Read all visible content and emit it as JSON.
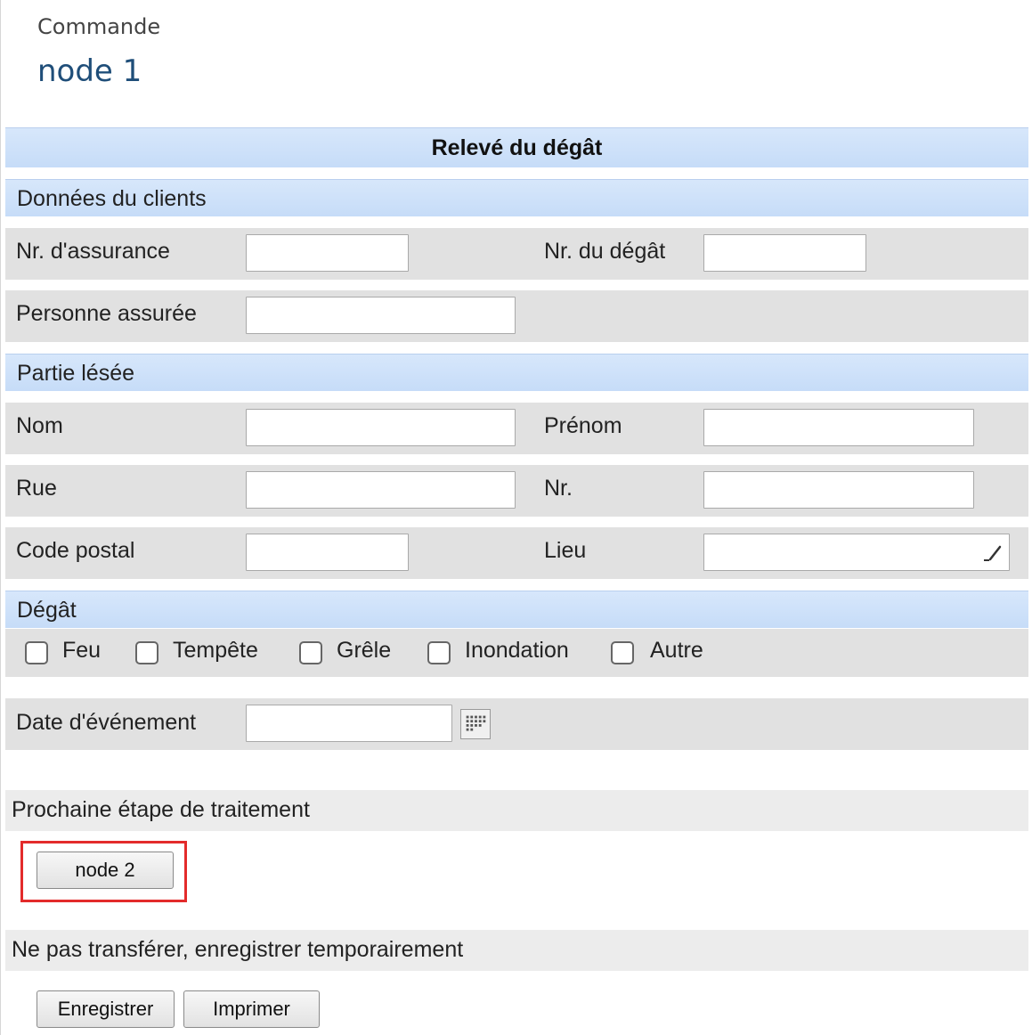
{
  "header": {
    "kicker": "Commande",
    "title": "node 1"
  },
  "form": {
    "title": "Relevé du dégât",
    "sections": {
      "client": "Données du clients",
      "injured": "Partie lésée",
      "damage": "Dégât"
    },
    "labels": {
      "insurance_nr": "Nr. d'assurance",
      "damage_nr": "Nr. du dégât",
      "insured_person": "Personne assurée",
      "last_name": "Nom",
      "first_name": "Prénom",
      "street": "Rue",
      "street_nr": "Nr.",
      "postal_code": "Code postal",
      "place": "Lieu",
      "event_date": "Date d'événement"
    },
    "values": {
      "insurance_nr": "",
      "damage_nr": "",
      "insured_person": "",
      "last_name": "",
      "first_name": "",
      "street": "",
      "street_nr": "",
      "postal_code": "",
      "place": "",
      "event_date": ""
    },
    "damage_types": [
      "Feu",
      "Tempête",
      "Grêle",
      "Inondation",
      "Autre"
    ]
  },
  "next_step": {
    "heading": "Prochaine étape de traitement",
    "button": "node 2"
  },
  "temp_save": {
    "heading": "Ne pas transférer, enregistrer temporairement",
    "save": "Enregistrer",
    "print": "Imprimer"
  },
  "colors": {
    "accent_title": "#1f4e79",
    "section_blue": "#c6dcf8",
    "row_grey": "#e1e1e1",
    "highlight": "#e32b2b"
  }
}
